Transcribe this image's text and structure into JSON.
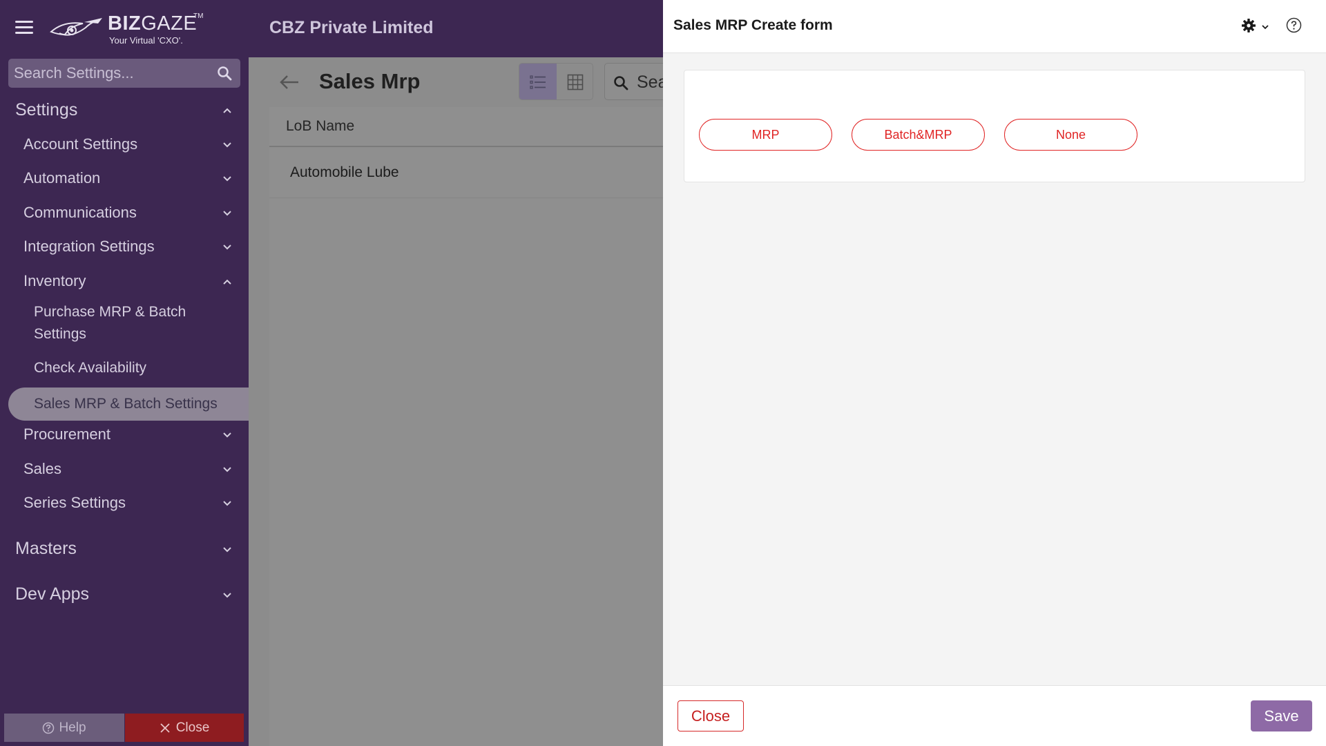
{
  "topbar": {
    "menu_icon": "hamburger-icon",
    "logo": {
      "brand": "BIZ GAZE",
      "brand_bold": "BIZ",
      "brand_light": "GAZE",
      "tm": "TM",
      "tagline": "Your Virtual 'CXO'."
    },
    "company": "CBZ Private Limited"
  },
  "sidebar": {
    "search": {
      "placeholder": "Search Settings...",
      "value": "",
      "icon": "search-icon"
    },
    "items": [
      {
        "label": "Settings",
        "level": 0,
        "expanded": true
      },
      {
        "label": "Account Settings",
        "level": 1,
        "expanded": false
      },
      {
        "label": "Automation",
        "level": 1,
        "expanded": false
      },
      {
        "label": "Communications",
        "level": 1,
        "expanded": false
      },
      {
        "label": "Integration Settings",
        "level": 1,
        "expanded": false
      },
      {
        "label": "Inventory",
        "level": 1,
        "expanded": true
      },
      {
        "label": "Purchase MRP & Batch",
        "label2": "Settings",
        "level": 2
      },
      {
        "label": "Check Availability",
        "level": 2
      },
      {
        "label": "Sales MRP & Batch Settings",
        "level": 2,
        "active": true
      },
      {
        "label": "Procurement",
        "level": 1,
        "expanded": false
      },
      {
        "label": "Sales",
        "level": 1,
        "expanded": false
      },
      {
        "label": "Series Settings",
        "level": 1,
        "expanded": false
      },
      {
        "label": "Masters",
        "level": 0,
        "expanded": false
      },
      {
        "label": "Dev Apps",
        "level": 0,
        "expanded": false
      }
    ],
    "help_label": "Help",
    "close_label": "Close"
  },
  "main": {
    "title": "Sales Mrp",
    "search_partial": "Sea",
    "table": {
      "columns": [
        "LoB Name"
      ],
      "rows": [
        [
          "Automobile Lube"
        ]
      ]
    }
  },
  "drawer": {
    "title": "Sales MRP Create form",
    "options": [
      "MRP",
      "Batch&MRP",
      "None"
    ],
    "close_label": "Close",
    "save_label": "Save"
  },
  "colors": {
    "sidebar_bg": "#3d2752",
    "accent_red": "#e02424",
    "save_purple": "#8e6aa6",
    "close_red_bg": "#8e1c20"
  }
}
